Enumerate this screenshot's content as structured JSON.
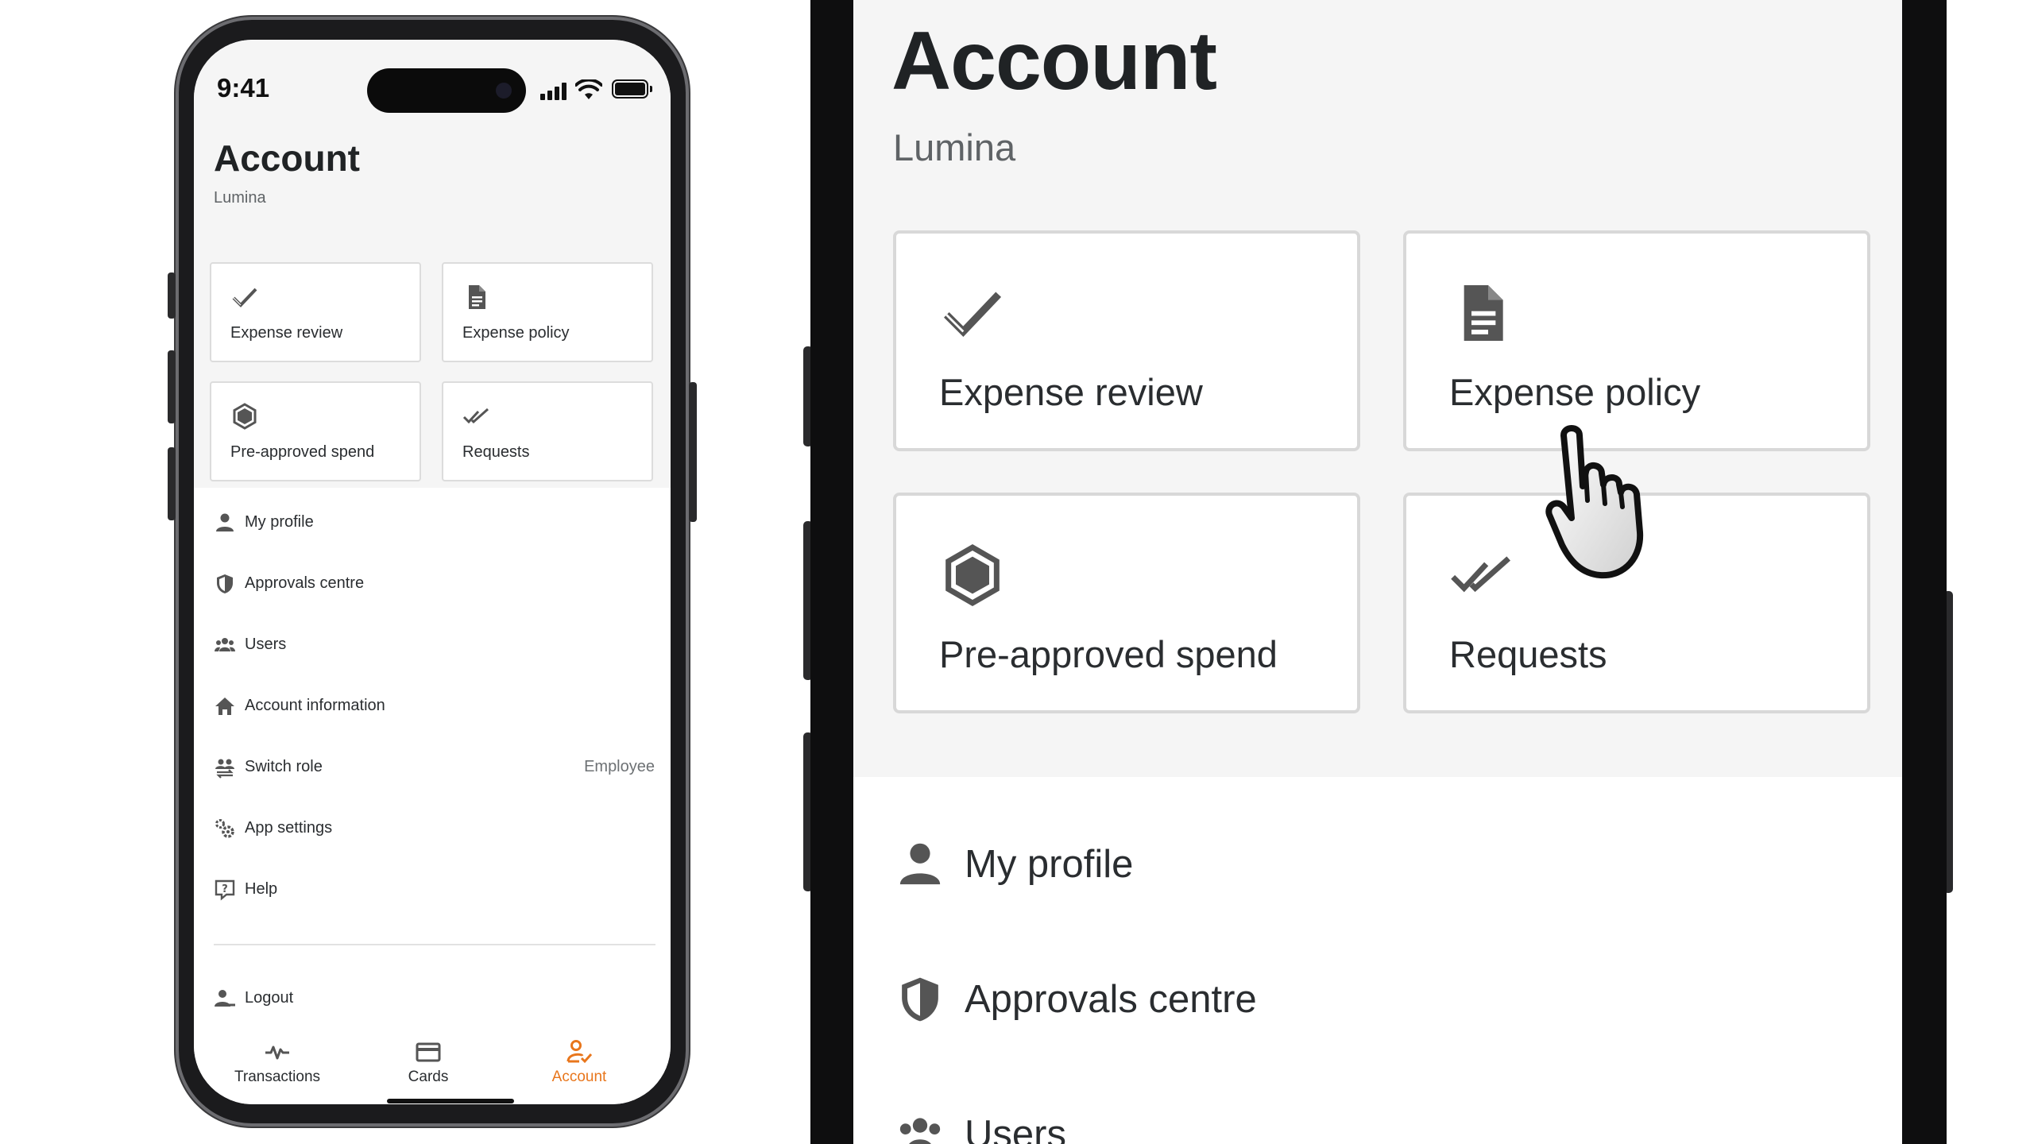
{
  "status": {
    "time": "9:41"
  },
  "account": {
    "title": "Account",
    "subtitle": "Lumina"
  },
  "tiles": [
    {
      "label": "Expense review",
      "icon": "check-icon"
    },
    {
      "label": "Expense policy",
      "icon": "document-icon"
    },
    {
      "label": "Pre-approved spend",
      "icon": "hexagon-icon"
    },
    {
      "label": "Requests",
      "icon": "double-check-icon"
    }
  ],
  "menu": [
    {
      "label": "My profile",
      "icon": "person-icon"
    },
    {
      "label": "Approvals centre",
      "icon": "shield-icon"
    },
    {
      "label": "Users",
      "icon": "group-icon"
    },
    {
      "label": "Account information",
      "icon": "home-icon"
    },
    {
      "label": "Switch role",
      "icon": "switch-role-icon",
      "value": "Employee"
    },
    {
      "label": "App settings",
      "icon": "gears-icon"
    },
    {
      "label": "Help",
      "icon": "help-icon"
    }
  ],
  "logout": {
    "label": "Logout",
    "icon": "logout-icon"
  },
  "bottom_nav": [
    {
      "label": "Transactions",
      "icon": "activity-icon",
      "active": false
    },
    {
      "label": "Cards",
      "icon": "card-icon",
      "active": false
    },
    {
      "label": "Account",
      "icon": "account-icon",
      "active": true
    }
  ],
  "colors": {
    "accent": "#e8761c",
    "background": "#f5f5f5",
    "text": "#202325"
  }
}
